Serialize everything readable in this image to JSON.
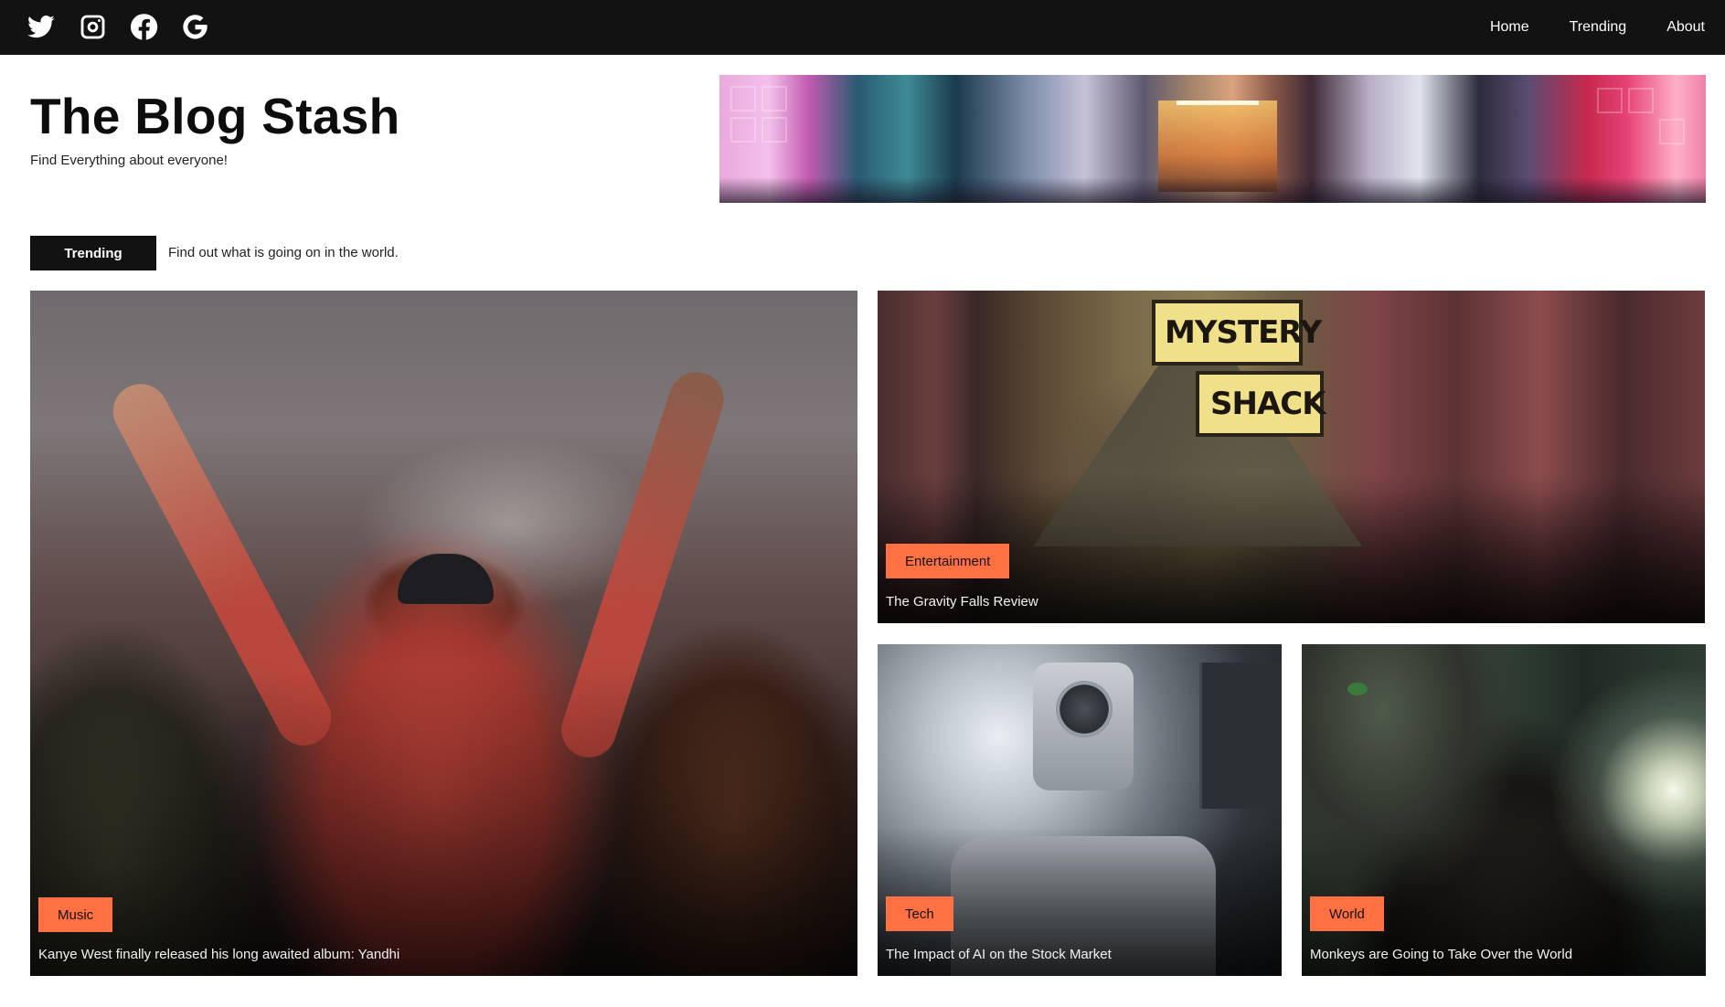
{
  "navbar": {
    "social": [
      {
        "icon": "twitter-icon"
      },
      {
        "icon": "instagram-icon"
      },
      {
        "icon": "facebook-icon"
      },
      {
        "icon": "google-icon"
      }
    ],
    "links": [
      "Home",
      "Trending",
      "About"
    ]
  },
  "header": {
    "title": "The Blog Stash",
    "tagline": "Find Everything about everyone!"
  },
  "trending": {
    "badge": "Trending",
    "text": "Find out what is going on in the world."
  },
  "cards": {
    "music": {
      "tag": "Music",
      "caption": "Kanye West finally released his long awaited album: Yandhi"
    },
    "entertainment": {
      "tag": "Entertainment",
      "caption": "The Gravity Falls Review",
      "sign_line1": "MYSTERY",
      "sign_line2": "SHACK"
    },
    "tech": {
      "tag": "Tech",
      "caption": "The Impact of AI on the Stock Market"
    },
    "world": {
      "tag": "World",
      "caption": "Monkeys are Going to Take Over the World"
    }
  },
  "colors": {
    "navbar_bg": "#121212",
    "tag_accent": "#ff7043",
    "badge_bg": "#121212"
  }
}
